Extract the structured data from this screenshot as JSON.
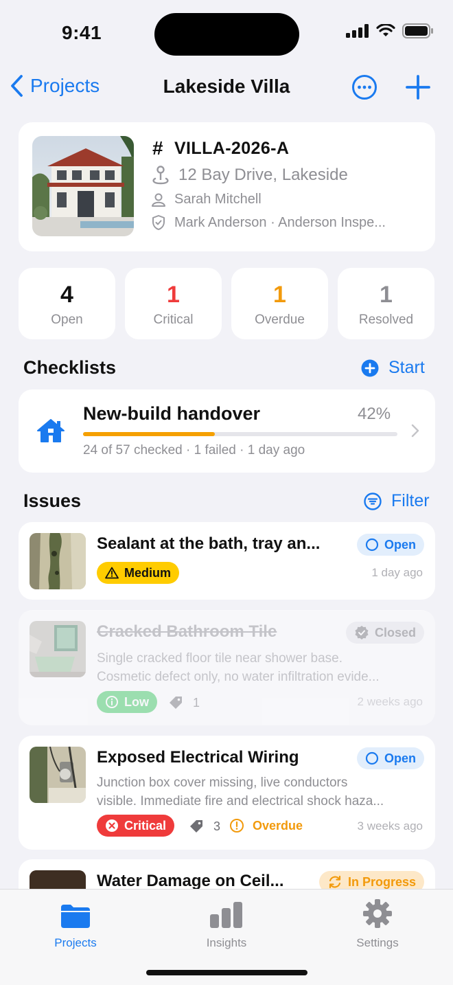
{
  "status_bar": {
    "time": "9:41"
  },
  "nav": {
    "back_label": "Projects",
    "title": "Lakeside Villa"
  },
  "project": {
    "code_prefix": "#",
    "code": "VILLA-2026-A",
    "address": "12 Bay Drive, Lakeside",
    "client": "Sarah Mitchell",
    "inspector": "Mark Anderson · Anderson Inspe..."
  },
  "stats": [
    {
      "value": "4",
      "label": "Open",
      "color": "#111111"
    },
    {
      "value": "1",
      "label": "Critical",
      "color": "#ef3b3b"
    },
    {
      "value": "1",
      "label": "Overdue",
      "color": "#f29a0c"
    },
    {
      "value": "1",
      "label": "Resolved",
      "color": "#8e8e93"
    }
  ],
  "checklists": {
    "heading": "Checklists",
    "action": "Start",
    "item": {
      "title": "New-build handover",
      "percent": "42%",
      "progress": 0.42,
      "meta": "24 of 57 checked · 1 failed · 1 day ago"
    }
  },
  "issues": {
    "heading": "Issues",
    "action": "Filter",
    "items": [
      {
        "title": "Sealant at the bath, tray an...",
        "status": "Open",
        "severity": "Medium",
        "time": "1 day ago"
      },
      {
        "title": "Cracked Bathroom Tile",
        "status": "Closed",
        "desc1": "Single cracked floor tile near shower base.",
        "desc2": "Cosmetic defect only, no water infiltration evide...",
        "severity": "Low",
        "tags": "1",
        "time": "2 weeks ago"
      },
      {
        "title": "Exposed Electrical Wiring",
        "status": "Open",
        "desc1": "Junction box cover missing, live conductors",
        "desc2": "visible. Immediate fire and electrical shock haza...",
        "severity": "Critical",
        "tags": "3",
        "overdue": "Overdue",
        "time": "3 weeks ago"
      },
      {
        "title": "Water Damage on Ceil...",
        "status": "In Progress"
      }
    ]
  },
  "tabs": [
    {
      "label": "Projects",
      "icon": "folder-icon",
      "active": true
    },
    {
      "label": "Insights",
      "icon": "bar-chart-icon",
      "active": false
    },
    {
      "label": "Settings",
      "icon": "gear-icon",
      "active": false
    }
  ],
  "colors": {
    "accent": "#1a7aef",
    "background": "#f2f2f7",
    "critical": "#ef3b3b",
    "warning": "#f29a0c",
    "medium": "#ffcc00",
    "low": "#5ecf6f"
  }
}
